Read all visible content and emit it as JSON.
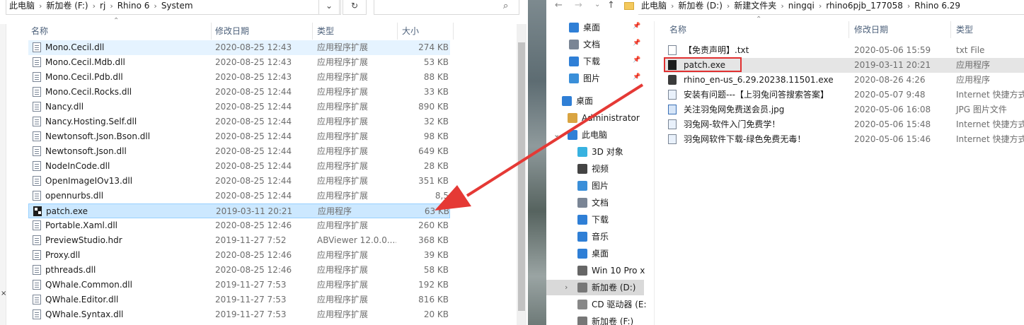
{
  "left": {
    "breadcrumb": [
      "此电脑",
      "新加卷 (F:)",
      "rj",
      "Rhino 6",
      "System"
    ],
    "columns": {
      "name": "名称",
      "date": "修改日期",
      "type": "类型",
      "size": "大小"
    },
    "files": [
      {
        "name": "Mono.Cecil.dll",
        "date": "2020-08-25 12:43",
        "type": "应用程序扩展",
        "size": "274 KB",
        "icon": "dll-file-icon",
        "state": "hover"
      },
      {
        "name": "Mono.Cecil.Mdb.dll",
        "date": "2020-08-25 12:43",
        "type": "应用程序扩展",
        "size": "53 KB",
        "icon": "dll-file-icon"
      },
      {
        "name": "Mono.Cecil.Pdb.dll",
        "date": "2020-08-25 12:43",
        "type": "应用程序扩展",
        "size": "88 KB",
        "icon": "dll-file-icon"
      },
      {
        "name": "Mono.Cecil.Rocks.dll",
        "date": "2020-08-25 12:44",
        "type": "应用程序扩展",
        "size": "33 KB",
        "icon": "dll-file-icon"
      },
      {
        "name": "Nancy.dll",
        "date": "2020-08-25 12:44",
        "type": "应用程序扩展",
        "size": "890 KB",
        "icon": "dll-file-icon"
      },
      {
        "name": "Nancy.Hosting.Self.dll",
        "date": "2020-08-25 12:44",
        "type": "应用程序扩展",
        "size": "32 KB",
        "icon": "dll-file-icon"
      },
      {
        "name": "Newtonsoft.Json.Bson.dll",
        "date": "2020-08-25 12:44",
        "type": "应用程序扩展",
        "size": "98 KB",
        "icon": "dll-file-icon"
      },
      {
        "name": "Newtonsoft.Json.dll",
        "date": "2020-08-25 12:44",
        "type": "应用程序扩展",
        "size": "649 KB",
        "icon": "dll-file-icon"
      },
      {
        "name": "NodeInCode.dll",
        "date": "2020-08-25 12:44",
        "type": "应用程序扩展",
        "size": "28 KB",
        "icon": "dll-file-icon"
      },
      {
        "name": "OpenImageIOv13.dll",
        "date": "2020-08-25 12:44",
        "type": "应用程序扩展",
        "size": "351 KB",
        "icon": "dll-file-icon"
      },
      {
        "name": "opennurbs.dll",
        "date": "2020-08-25 12:44",
        "type": "应用程序扩展",
        "size": "8,5",
        "icon": "dll-file-icon"
      },
      {
        "name": "patch.exe",
        "date": "2019-03-11 20:21",
        "type": "应用程序",
        "size": "63 KB",
        "icon": "exe-file-icon",
        "state": "selected"
      },
      {
        "name": "Portable.Xaml.dll",
        "date": "2020-08-25 12:46",
        "type": "应用程序扩展",
        "size": "260 KB",
        "icon": "dll-file-icon"
      },
      {
        "name": "PreviewStudio.hdr",
        "date": "2019-11-27 7:52",
        "type": "ABViewer 12.0.0....",
        "size": "368 KB",
        "icon": "hdr-file-icon"
      },
      {
        "name": "Proxy.dll",
        "date": "2020-08-25 12:46",
        "type": "应用程序扩展",
        "size": "39 KB",
        "icon": "dll-file-icon"
      },
      {
        "name": "pthreads.dll",
        "date": "2020-08-25 12:46",
        "type": "应用程序扩展",
        "size": "58 KB",
        "icon": "dll-file-icon"
      },
      {
        "name": "QWhale.Common.dll",
        "date": "2019-11-27 7:53",
        "type": "应用程序扩展",
        "size": "192 KB",
        "icon": "dll-file-icon"
      },
      {
        "name": "QWhale.Editor.dll",
        "date": "2019-11-27 7:53",
        "type": "应用程序扩展",
        "size": "816 KB",
        "icon": "dll-file-icon"
      },
      {
        "name": "QWhale.Syntax.dll",
        "date": "2019-11-27 7:53",
        "type": "应用程序扩展",
        "size": "20 KB",
        "icon": "dll-file-icon"
      }
    ]
  },
  "right": {
    "breadcrumb": [
      "此电脑",
      "新加卷 (D:)",
      "新建文件夹",
      "ningqi",
      "rhino6pjb_177058",
      "Rhino 6.29"
    ],
    "nav": [
      {
        "label": "桌面",
        "icon": "desktop-icon",
        "pinned": true
      },
      {
        "label": "文档",
        "icon": "documents-icon",
        "pinned": true
      },
      {
        "label": "下载",
        "icon": "download-icon",
        "pinned": true
      },
      {
        "label": "图片",
        "icon": "pictures-icon",
        "pinned": true
      },
      {
        "label": "桌面",
        "icon": "desktop-icon",
        "pinned": false
      },
      {
        "label": "Administrator",
        "icon": "user-icon",
        "pinned": false
      },
      {
        "label": "此电脑",
        "icon": "this-pc-icon",
        "pinned": false
      },
      {
        "label": "3D 对象",
        "icon": "3d-objects-icon",
        "pinned": false
      },
      {
        "label": "视频",
        "icon": "videos-icon",
        "pinned": false
      },
      {
        "label": "图片",
        "icon": "pictures-icon",
        "pinned": false
      },
      {
        "label": "文档",
        "icon": "documents-icon",
        "pinned": false
      },
      {
        "label": "下载",
        "icon": "download-icon",
        "pinned": false
      },
      {
        "label": "音乐",
        "icon": "music-icon",
        "pinned": false
      },
      {
        "label": "桌面",
        "icon": "desktop-icon",
        "pinned": false
      },
      {
        "label": "Win 10 Pro x",
        "icon": "windows-drive-icon",
        "pinned": false
      },
      {
        "label": "新加卷 (D:)",
        "icon": "drive-icon",
        "pinned": false,
        "selected": true
      },
      {
        "label": "CD 驱动器 (E:",
        "icon": "cd-drive-icon",
        "pinned": false
      },
      {
        "label": "新加卷 (F:)",
        "icon": "drive-icon",
        "pinned": false
      }
    ],
    "columns": {
      "name": "名称",
      "date": "修改日期",
      "type": "类型"
    },
    "files": [
      {
        "name": "【免责声明】.txt",
        "date": "2020-05-06 15:59",
        "type": "txt File",
        "icon": "txt-file-icon"
      },
      {
        "name": "patch.exe",
        "date": "2019-03-11 20:21",
        "type": "应用程序",
        "icon": "exe-file-icon",
        "state": "hover"
      },
      {
        "name": "rhino_en-us_6.29.20238.11501.exe",
        "date": "2020-08-26 4:26",
        "type": "应用程序",
        "icon": "rhino-installer-icon"
      },
      {
        "name": "安装有问题---【上羽兔问答搜索答案】",
        "date": "2020-05-07 9:48",
        "type": "Internet 快捷方式",
        "icon": "internet-shortcut-icon"
      },
      {
        "name": "关注羽兔网免费送会员.jpg",
        "date": "2020-05-06 16:08",
        "type": "JPG 图片文件",
        "icon": "jpg-file-icon"
      },
      {
        "name": "羽兔网-软件入门免费学！",
        "date": "2020-05-06 15:48",
        "type": "Internet 快捷方式",
        "icon": "internet-shortcut-icon"
      },
      {
        "name": "羽兔网软件下载-绿色免费无毒！",
        "date": "2020-05-06 15:46",
        "type": "Internet 快捷方式",
        "icon": "internet-shortcut-icon"
      }
    ]
  },
  "colors": {
    "arrow": "#e53935",
    "highlight_box": "#e03030",
    "selected_row": "#cce8ff",
    "hover_row": "#e5f3ff"
  }
}
